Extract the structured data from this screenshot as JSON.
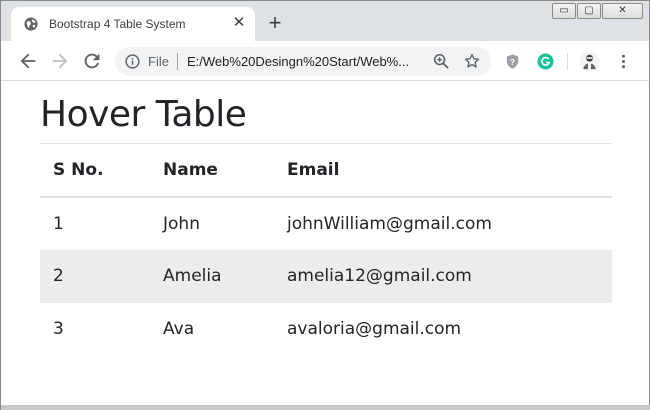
{
  "browser": {
    "tab": {
      "title": "Bootstrap 4 Table System",
      "close_glyph": "✕"
    },
    "new_tab_glyph": "+",
    "window_controls": {
      "minimize": "▭",
      "maximize": "▢",
      "close": "✕"
    },
    "address_bar": {
      "scheme_label": "File",
      "url": "E:/Web%20Desingn%20Start/Web%..."
    },
    "icons": {
      "back": "back-arrow-icon",
      "forward": "forward-arrow-icon",
      "reload": "reload-icon",
      "site_info": "info-icon",
      "zoom": "zoom-icon",
      "bookmark": "star-icon",
      "extension_shield": "shield-extension-icon",
      "extension_grammarly": "grammarly-extension-icon",
      "profile": "profile-avatar-icon",
      "menu": "kebab-menu-icon"
    }
  },
  "page": {
    "title": "Hover Table",
    "table": {
      "headers": [
        "S No.",
        "Name",
        "Email"
      ],
      "rows": [
        [
          "1",
          "John",
          "johnWilliam@gmail.com"
        ],
        [
          "2",
          "Amelia",
          "amelia12@gmail.com"
        ],
        [
          "3",
          "Ava",
          "avaloria@gmail.com"
        ]
      ],
      "hovered_row_index": 1
    }
  },
  "colors": {
    "tabstrip_bg": "#dee1e6",
    "omnibox_bg": "#f1f3f4",
    "hover_row_bg": "#ececec",
    "table_border": "#dee2e6",
    "grammarly_green": "#15c39a"
  }
}
